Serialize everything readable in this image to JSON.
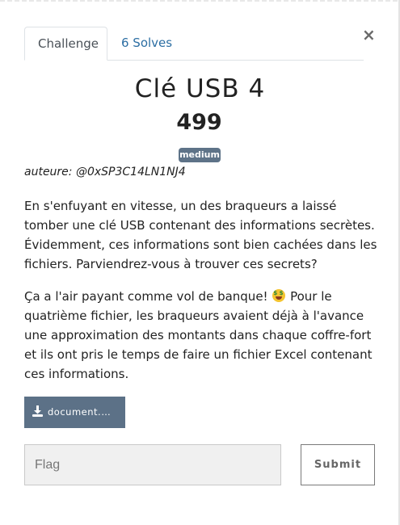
{
  "tabs": {
    "challenge_label": "Challenge",
    "solves_label": "6 Solves"
  },
  "close_label": "×",
  "challenge": {
    "name": "Clé USB 4",
    "value": "499",
    "difficulty": "medium",
    "author": "auteure: @0xSP3C14LN1NJ4",
    "description_p1": "En s'enfuyant en vitesse, un des braqueurs a laissé tomber une clé USB contenant des informations secrètes. Évidemment, ces informations sont bien cachées dans les fichiers. Parviendrez-vous à trouver ces secrets?",
    "description_p2_before": "Ça a l'air payant comme vol de banque! ",
    "description_p2_after": " Pour le quatrième fichier, les braqueurs avaient déjà à l'avance une approximation des montants dans chaque coffre-fort et ils ont pris le temps de faire un fichier Excel contenant ces informations.",
    "emoji_icon": "money-mouth-face-icon"
  },
  "file": {
    "name": "document.xl..."
  },
  "flag": {
    "placeholder": "Flag",
    "value": ""
  },
  "submit_label": "Submit",
  "colors": {
    "tab_link": "#2c6ea3",
    "badge_bg": "#5e7388",
    "download_bg": "#5c7187",
    "input_bg": "#f0f0f0"
  }
}
